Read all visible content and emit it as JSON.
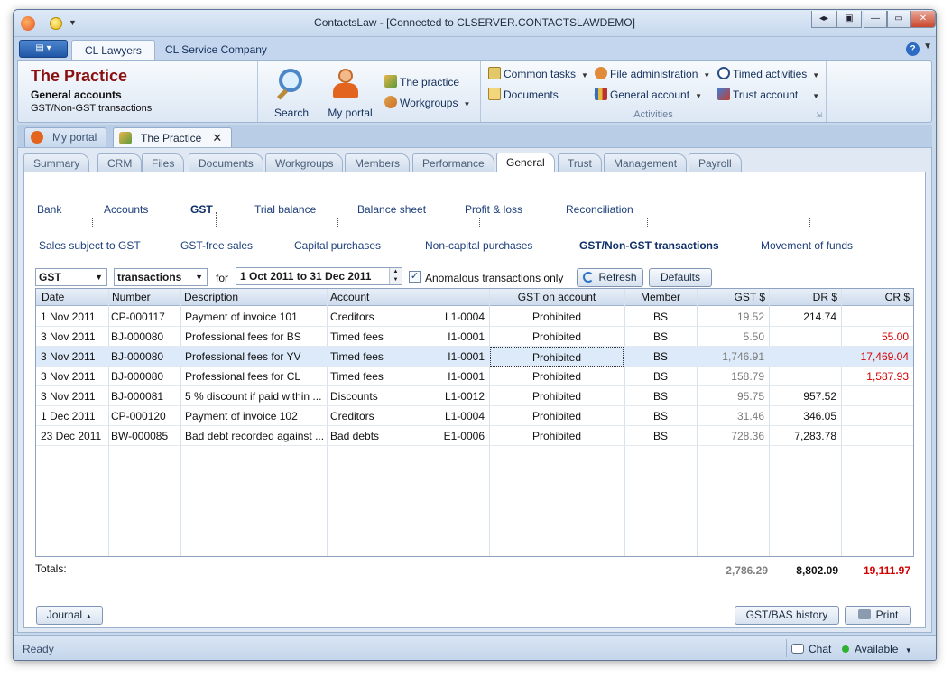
{
  "window": {
    "title": "ContactsLaw - [Connected to CLSERVER.CONTACTSLAWDEMO]"
  },
  "ribbon": {
    "tabs": [
      "CL Lawyers",
      "CL Service Company"
    ],
    "practice": {
      "title": "The Practice",
      "subtitle": "General accounts",
      "subtitle2": "GST/Non-GST transactions"
    },
    "search_label": "Search",
    "myportal_label": "My portal",
    "the_practice_label": "The practice",
    "workgroups_label": "Workgroups",
    "activities": {
      "common_tasks": "Common tasks",
      "documents": "Documents",
      "file_administration": "File administration",
      "general_account": "General account",
      "timed_activities": "Timed activities",
      "trust_account": "Trust account",
      "group_label": "Activities"
    }
  },
  "doc_tabs": [
    "My portal",
    "The Practice"
  ],
  "page_tabs": [
    "Summary",
    "CRM",
    "Files",
    "Documents",
    "Workgroups",
    "Members",
    "Performance",
    "General",
    "Trust",
    "Management",
    "Payroll"
  ],
  "subnav": {
    "level1": [
      "Bank",
      "Accounts",
      "GST",
      "Trial balance",
      "Balance sheet",
      "Profit & loss",
      "Reconciliation"
    ],
    "level2": [
      "Sales subject to GST",
      "GST-free sales",
      "Capital purchases",
      "Non-capital purchases",
      "GST/Non-GST transactions",
      "Movement of funds"
    ]
  },
  "filters": {
    "type_value": "GST",
    "view_value": "transactions",
    "for_label": "for",
    "date_range": "1 Oct 2011 to 31 Dec 2011",
    "anomalous_label": "Anomalous transactions only",
    "anomalous_checked": true,
    "refresh_label": "Refresh",
    "defaults_label": "Defaults"
  },
  "grid": {
    "columns": [
      "Date",
      "Number",
      "Description",
      "Account",
      "GST on account",
      "Member",
      "GST $",
      "DR $",
      "CR $"
    ],
    "rows": [
      {
        "date": "1 Nov 2011",
        "number": "CP-000117",
        "description": "Payment of invoice 101",
        "account": "Creditors",
        "code": "L1-0004",
        "gst_on_account": "Prohibited",
        "member": "BS",
        "gst": "19.52",
        "dr": "214.74",
        "cr": ""
      },
      {
        "date": "3 Nov 2011",
        "number": "BJ-000080",
        "description": "Professional fees for BS",
        "account": "Timed fees",
        "code": "I1-0001",
        "gst_on_account": "Prohibited",
        "member": "BS",
        "gst": "5.50",
        "dr": "",
        "cr": "55.00"
      },
      {
        "date": "3 Nov 2011",
        "number": "BJ-000080",
        "description": "Professional fees for YV",
        "account": "Timed fees",
        "code": "I1-0001",
        "gst_on_account": "Prohibited",
        "member": "BS",
        "gst": "1,746.91",
        "dr": "",
        "cr": "17,469.04"
      },
      {
        "date": "3 Nov 2011",
        "number": "BJ-000080",
        "description": "Professional fees for CL",
        "account": "Timed fees",
        "code": "I1-0001",
        "gst_on_account": "Prohibited",
        "member": "BS",
        "gst": "158.79",
        "dr": "",
        "cr": "1,587.93"
      },
      {
        "date": "3 Nov 2011",
        "number": "BJ-000081",
        "description": "5 % discount if paid within ...",
        "account": "Discounts",
        "code": "L1-0012",
        "gst_on_account": "Prohibited",
        "member": "BS",
        "gst": "95.75",
        "dr": "957.52",
        "cr": ""
      },
      {
        "date": "1 Dec 2011",
        "number": "CP-000120",
        "description": "Payment of invoice 102",
        "account": "Creditors",
        "code": "L1-0004",
        "gst_on_account": "Prohibited",
        "member": "BS",
        "gst": "31.46",
        "dr": "346.05",
        "cr": ""
      },
      {
        "date": "23 Dec 2011",
        "number": "BW-000085",
        "description": "Bad debt recorded against ...",
        "account": "Bad debts",
        "code": "E1-0006",
        "gst_on_account": "Prohibited",
        "member": "BS",
        "gst": "728.36",
        "dr": "7,283.78",
        "cr": ""
      }
    ],
    "selected_row": 2
  },
  "totals": {
    "label": "Totals:",
    "gst": "2,786.29",
    "dr": "8,802.09",
    "cr": "19,111.97"
  },
  "bottom": {
    "journal_label": "Journal",
    "history_label": "GST/BAS history",
    "print_label": "Print"
  },
  "status": {
    "text": "Ready",
    "chat_label": "Chat",
    "availability": "Available"
  },
  "colors": {
    "title_red": "#8a0f0f",
    "credit_red": "#d40000",
    "available_green": "#2fb12f"
  }
}
